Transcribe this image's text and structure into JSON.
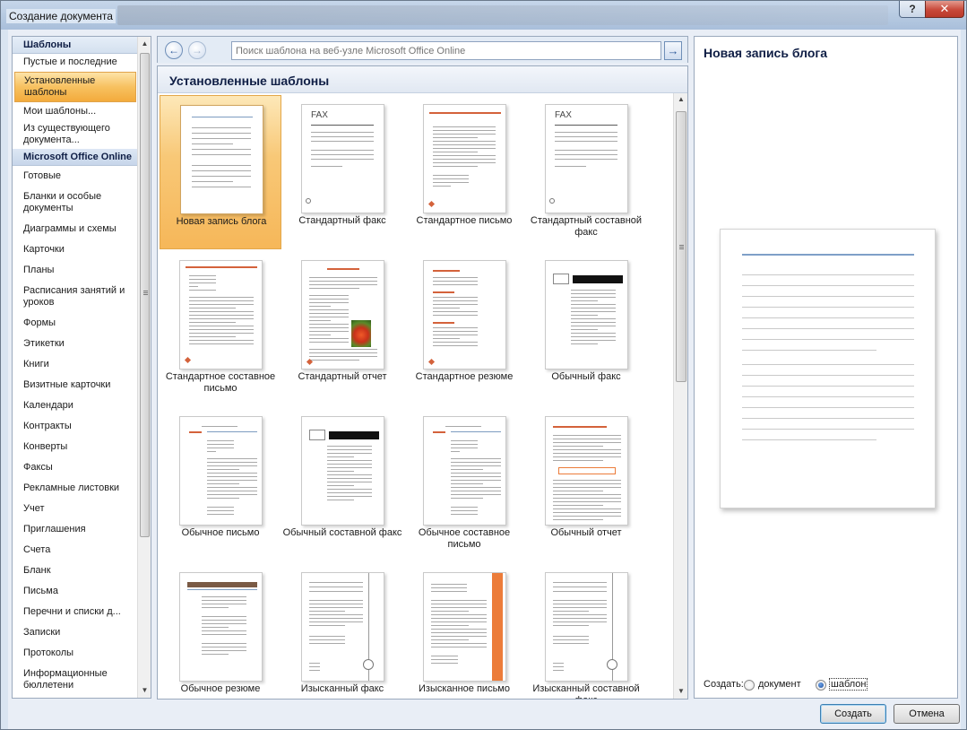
{
  "window": {
    "title": "Создание документа",
    "help_label": "?",
    "close_label": "✕"
  },
  "sidebar": {
    "header_templates": "Шаблоны",
    "header_online": "Microsoft Office Online",
    "local_items": [
      {
        "label": "Пустые и последние"
      },
      {
        "label": "Установленные шаблоны",
        "selected": true
      },
      {
        "label": "Мои шаблоны..."
      },
      {
        "label": "Из существующего документа..."
      }
    ],
    "online_items": [
      "Готовые",
      "Бланки и особые документы",
      "Диаграммы и схемы",
      "Карточки",
      "Планы",
      "Расписания занятий и уроков",
      "Формы",
      "Этикетки",
      "Книги",
      "Визитные карточки",
      "Календари",
      "Контракты",
      "Конверты",
      "Факсы",
      "Рекламные листовки",
      "Учет",
      "Приглашения",
      "Счета",
      "Бланк",
      "Письма",
      "Перечни и списки д...",
      "Записки",
      "Протоколы",
      "Информационные бюллетени"
    ]
  },
  "search": {
    "placeholder": "Поиск шаблона на веб-узле Microsoft Office Online",
    "value": ""
  },
  "center": {
    "title": "Установленные шаблоны",
    "templates": [
      {
        "label": "Новая запись блога",
        "style": "blog",
        "selected": true
      },
      {
        "label": "Стандартный факс",
        "style": "fax"
      },
      {
        "label": "Стандартное письмо",
        "style": "letter"
      },
      {
        "label": "Стандартный составной факс",
        "style": "fax"
      },
      {
        "label": "Стандартное составное письмо",
        "style": "merge-letter"
      },
      {
        "label": "Стандартный отчет",
        "style": "report"
      },
      {
        "label": "Стандартное резюме",
        "style": "resume"
      },
      {
        "label": "Обычный факс",
        "style": "black-fax"
      },
      {
        "label": "Обычное письмо",
        "style": "plain-letter"
      },
      {
        "label": "Обычный составной факс",
        "style": "black-fax"
      },
      {
        "label": "Обычное составное письмо",
        "style": "plain-letter"
      },
      {
        "label": "Обычный отчет",
        "style": "plain-report"
      },
      {
        "label": "Обычное резюме",
        "style": "plain-resume"
      },
      {
        "label": "Изысканный факс",
        "style": "elegant"
      },
      {
        "label": "Изысканное письмо",
        "style": "elegant-letter"
      },
      {
        "label": "Изысканный составной факс",
        "style": "elegant"
      }
    ],
    "fax_word": "FAX"
  },
  "preview": {
    "title": "Новая запись блога",
    "create_label": "Создать:",
    "option_document": "документ",
    "option_template": "шаблон",
    "selected_option": "template"
  },
  "buttons": {
    "create": "Создать",
    "cancel": "Отмена"
  },
  "icons": {
    "back": "arrow-left-icon",
    "forward": "arrow-right-icon",
    "go": "arrow-right-icon"
  }
}
